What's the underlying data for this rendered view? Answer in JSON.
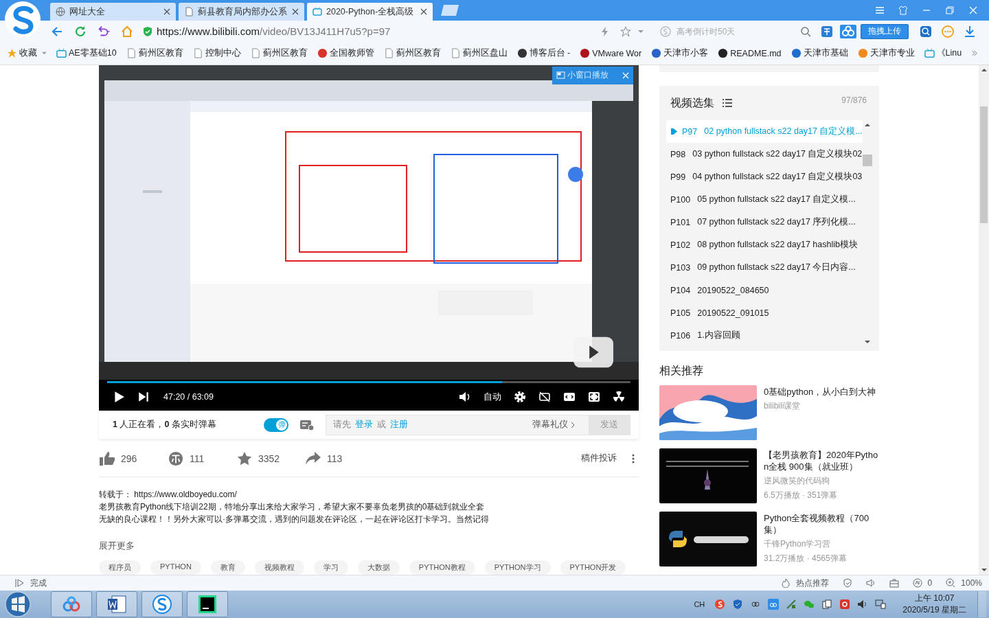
{
  "browser": {
    "tabs": [
      {
        "title": "网址大全",
        "selected": false
      },
      {
        "title": "蓟县教育局内部办公系",
        "selected": false
      },
      {
        "title": "2020-Python-全栈高级",
        "selected": true
      }
    ],
    "address": {
      "host": "https://www.bilibili.com",
      "path": "/video/BV13J411H7u5?p=97"
    },
    "search": {
      "placeholder": "高考倒计时50天"
    },
    "upload_button": "拖拽上传",
    "bookmarks": [
      {
        "label": "收藏",
        "kind": "star"
      },
      {
        "label": "AE零基础10",
        "kind": "tv"
      },
      {
        "label": "蓟州区教育",
        "kind": "page"
      },
      {
        "label": "控制中心",
        "kind": "page"
      },
      {
        "label": "蓟州区教育",
        "kind": "page"
      },
      {
        "label": "全国教师管",
        "kind": "mark",
        "color": "#d9342b"
      },
      {
        "label": "蓟州区教育",
        "kind": "page"
      },
      {
        "label": "蓟州区盘山",
        "kind": "page"
      },
      {
        "label": "博客后台 -",
        "kind": "mark",
        "color": "#333333"
      },
      {
        "label": "VMware Wor",
        "kind": "mark",
        "color": "#b0121b"
      },
      {
        "label": "天津市小客",
        "kind": "mark",
        "color": "#2a62c9"
      },
      {
        "label": "README.md",
        "kind": "mark",
        "color": "#222222"
      },
      {
        "label": "天津市基础",
        "kind": "mark",
        "color": "#1f6fd1"
      },
      {
        "label": "天津市专业",
        "kind": "mark",
        "color": "#f08a1c"
      },
      {
        "label": "《Linu",
        "kind": "tv"
      }
    ]
  },
  "player": {
    "mini_button": "小窗口播放",
    "level": 0.754,
    "time": "47:20 / 63:09",
    "quality": "自动"
  },
  "danmaku": {
    "viewers": "**1** 人正在看，**0** 条实时弹幕",
    "toggle_label": "弹",
    "on": true,
    "prompt": "请先",
    "login": "登录",
    "or": "或",
    "register": "注册",
    "etiquette": "弹幕礼仪",
    "send": "发送",
    "send_disabled": true
  },
  "stats": [
    {
      "kind": "like",
      "count": "296"
    },
    {
      "kind": "coin",
      "count": "111"
    },
    {
      "kind": "favorite",
      "count": "3352"
    },
    {
      "kind": "share",
      "count": "113"
    }
  ],
  "report": "稿件投诉",
  "description": {
    "lines": [
      "转载于： https://www.oldboyedu.com/",
      "老男孩教育Python线下培训22期，特地分享出来给大家学习，希望大家不要辜负老男孩的0基础到就业全套",
      "无缺的良心课程！！另外大家可以·多弹幕交流，遇到的问题发在评论区，一起在评论区打卡学习。当然记得"
    ],
    "more": "展开更多"
  },
  "tags": [
    "程序员",
    "PYTHON",
    "教育",
    "视频教程",
    "学习",
    "大数据",
    "PYTHON教程",
    "PYTHON学习",
    "PYTHON开发"
  ],
  "playlist": {
    "title": "视频选集",
    "count": "97/876",
    "items": [
      {
        "number": "P97",
        "title": "02 python fullstack s22 day17 自定义模...",
        "selected": true
      },
      {
        "number": "P98",
        "title": "03 python fullstack s22 day17 自定义模块02",
        "selected": false
      },
      {
        "number": "P99",
        "title": "04 python fullstack s22 day17 自定义模块03",
        "selected": false
      },
      {
        "number": "P100",
        "title": "05 python fullstack s22 day17 自定义模...",
        "selected": false
      },
      {
        "number": "P101",
        "title": "07 python fullstack s22 day17 序列化模...",
        "selected": false
      },
      {
        "number": "P102",
        "title": "08 python fullstack s22 day17 hashlib模块",
        "selected": false
      },
      {
        "number": "P103",
        "title": "09 python fullstack s22 day17 今日内容...",
        "selected": false
      },
      {
        "number": "P104",
        "title": "20190522_084650",
        "selected": false
      },
      {
        "number": "P105",
        "title": "20190522_091015",
        "selected": false
      },
      {
        "number": "P106",
        "title": "1.内容回顾",
        "selected": false
      }
    ]
  },
  "related": {
    "title": "相关推荐",
    "items": [
      {
        "title": "0基础python，从小白到大神",
        "author": "bilibili课堂"
      },
      {
        "title": "【老男孩教育】2020年Python全栈 900集（就业班）",
        "author": "逆风微笑的代码狗",
        "stats": "6.5万播放 · 351弹幕"
      },
      {
        "title": "Python全套视频教程（700集）",
        "author": "千锋Python学习营",
        "stats": "31.2万播放 · 4565弹幕"
      }
    ]
  },
  "status_bar": {
    "text": "完成",
    "hot": "热点推荐",
    "ad_count": "0",
    "zoom": "100%"
  },
  "taskbar": {
    "language": "CH",
    "time": "上午 10:07",
    "date": "2020/5/19 星期二"
  }
}
